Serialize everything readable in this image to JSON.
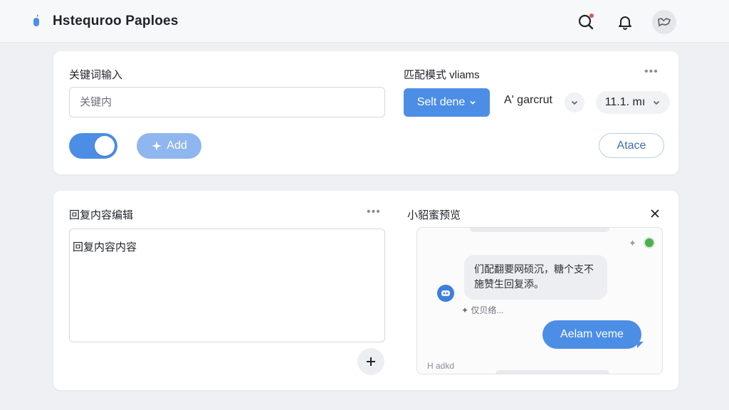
{
  "header": {
    "title": "Hstequroo Paploes",
    "icons": [
      "logo-icon",
      "search-icon",
      "bell-icon",
      "avatar-icon"
    ]
  },
  "keyword_section": {
    "label": "关键词输入",
    "input_placeholder": "关键内",
    "add_button_label": "Add",
    "toggle_on": true
  },
  "match_section": {
    "label": "匹配模式 vliams",
    "primary_select_label": "Selt dene",
    "secondary_select_label": "A' garcrut",
    "tertiary_select_label": "11.1. mı",
    "action_button_label": "Atace"
  },
  "reply_section": {
    "label": "回复内容编辑",
    "content": "回复内容内容"
  },
  "preview_section": {
    "label": "小貂蜜预览",
    "bot_message": "们配翻要网硕沉，糖个支不施赞生回复添。",
    "bot_meta": "仅贝络...",
    "user_message": "Aelam veme",
    "footer": "H adkd"
  },
  "colors": {
    "accent": "#4c8ee6",
    "accent_light": "#8fb6ee",
    "online": "#4caf50",
    "background": "#eef0f4"
  }
}
